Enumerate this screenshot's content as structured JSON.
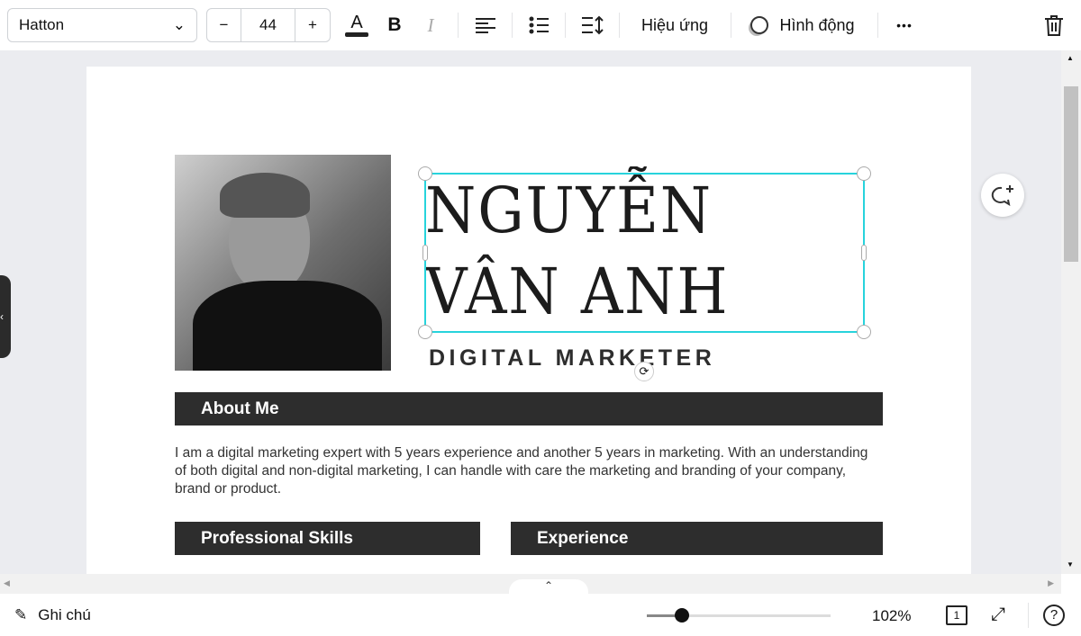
{
  "toolbar": {
    "font": "Hatton",
    "size": "44",
    "minus": "−",
    "plus": "+",
    "effects": "Hiệu ứng",
    "animate": "Hình động",
    "more": "•••"
  },
  "resume": {
    "name_line1": "NGUYỄN",
    "name_line2": "VÂN ANH",
    "title": "DIGITAL MARKETER",
    "about_heading": "About Me",
    "about_text": "I am a digital marketing expert with 5 years experience and another 5 years in marketing. With an understanding of both digital and non-digital marketing, I can handle with care the marketing and branding of your company, brand or product.",
    "skills_heading": "Professional Skills",
    "experience_heading": "Experience"
  },
  "footer": {
    "notes": "Ghi chú",
    "zoom": "102%",
    "zoom_slider_fraction": 0.19,
    "page_count": "1"
  },
  "colors": {
    "selection": "#27d3dc",
    "section_bar": "#2d2d2d"
  }
}
